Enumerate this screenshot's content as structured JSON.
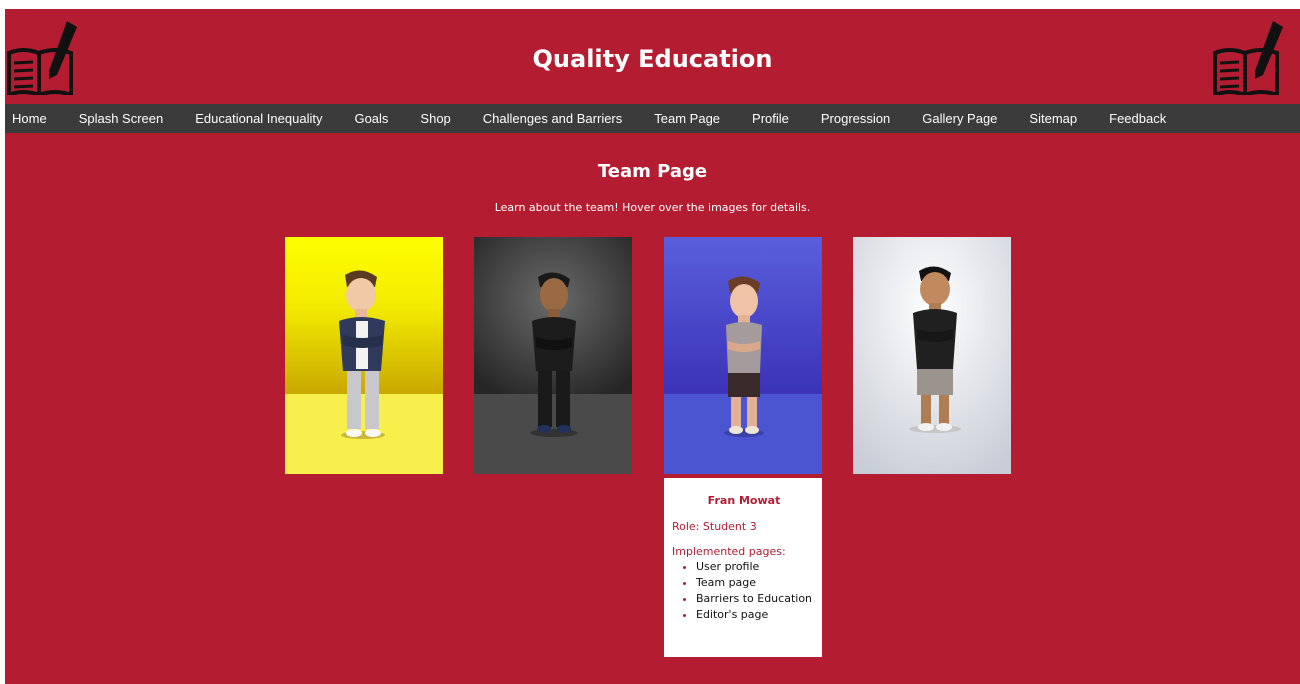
{
  "header": {
    "title": "Quality Education"
  },
  "icons": {
    "logo_left": "book-pencil-icon",
    "logo_right": "book-pencil-icon"
  },
  "nav": {
    "items": [
      {
        "label": "Home"
      },
      {
        "label": "Splash Screen"
      },
      {
        "label": "Educational Inequality"
      },
      {
        "label": "Goals"
      },
      {
        "label": "Shop"
      },
      {
        "label": "Challenges and Barriers"
      },
      {
        "label": "Team Page"
      },
      {
        "label": "Profile"
      },
      {
        "label": "Progression"
      },
      {
        "label": "Gallery Page"
      },
      {
        "label": "Sitemap"
      },
      {
        "label": "Feedback"
      }
    ]
  },
  "main": {
    "title": "Team Page",
    "subtitle": "Learn about the team! Hover over the images for details."
  },
  "details": {
    "name": "Fran Mowat",
    "role": "Role: Student 3",
    "implemented_label": "Implemented pages:",
    "pages": [
      "User profile",
      "Team page",
      "Barriers to Education",
      "Editor's page"
    ]
  },
  "colors": {
    "page_bg": "#b31c31",
    "nav_bg": "#3b3b3b",
    "card_bg_1": "#f5f04a",
    "card_bg_2": "#3c3c3c",
    "card_bg_3": "#4b55d2",
    "card_bg_4": "#f0f0f2"
  }
}
